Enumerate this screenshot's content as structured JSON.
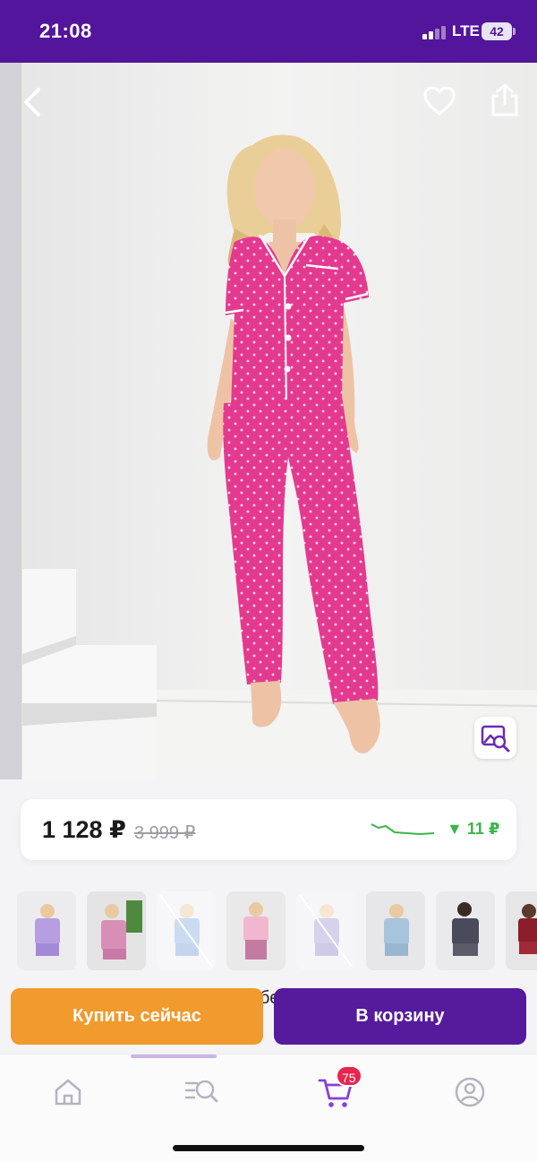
{
  "status_bar": {
    "time": "21:08",
    "network": "LTE",
    "battery": "42"
  },
  "hero": {
    "photo_icon": "product-photo",
    "back_icon": "chevron-left-icon",
    "favorite_icon": "heart-outline-icon",
    "share_icon": "share-icon",
    "visual_search_icon": "image-search-icon"
  },
  "price": {
    "current": "1 128 ₽",
    "old": "3 999 ₽",
    "change": "▼ 11 ₽",
    "change_color": "#3bb54a",
    "trend_icon": "price-trend-sparkline"
  },
  "thumbnails": [
    {
      "variant": "lavender-print",
      "sold_out": false
    },
    {
      "variant": "pink-stripe",
      "sold_out": false
    },
    {
      "variant": "light-blue",
      "sold_out": true
    },
    {
      "variant": "pink-plaid",
      "sold_out": false
    },
    {
      "variant": "lilac",
      "sold_out": true
    },
    {
      "variant": "blue-stripe",
      "sold_out": false
    },
    {
      "variant": "dark-print",
      "sold_out": false
    },
    {
      "variant": "burgundy",
      "sold_out": false
    }
  ],
  "behind_text": "бе",
  "actions": {
    "buy_now": "Купить сейчас",
    "add_to_cart": "В корзину",
    "buy_color": "#f19a2d",
    "cart_color": "#561a9c"
  },
  "tabbar": {
    "cart_badge": "75",
    "icons": [
      "home-icon",
      "catalog-search-icon",
      "cart-icon",
      "profile-icon"
    ]
  },
  "colors": {
    "brand": "#52159b",
    "accent": "#f19a2d",
    "badge": "#e8244f"
  }
}
